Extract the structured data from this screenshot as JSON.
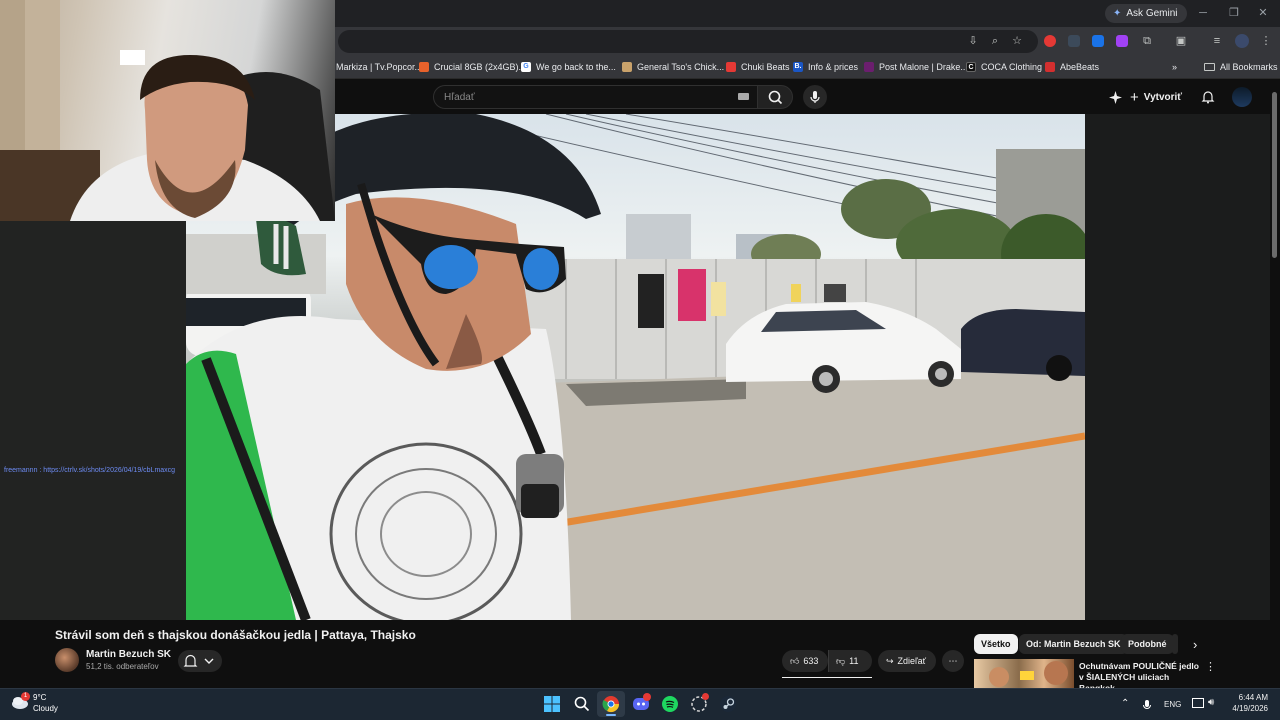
{
  "browser": {
    "ask_gemini": "Ask Gemini",
    "bookmarks": [
      {
        "label": "Markiza | Tv.Popcor...",
        "color": "#35363a",
        "glyph": ""
      },
      {
        "label": "Crucial 8GB (2x4GB)...",
        "color": "#e8622b",
        "glyph": ""
      },
      {
        "label": "We go back to the...",
        "color": "#ffffff",
        "glyph": "G"
      },
      {
        "label": "General Tso's Chick...",
        "color": "#c9a26b",
        "glyph": ""
      },
      {
        "label": "Chuki Beats",
        "color": "#e53935",
        "glyph": ""
      },
      {
        "label": "Info & prices",
        "color": "#1a56c5",
        "glyph": "B."
      },
      {
        "label": "Post Malone | Drake...",
        "color": "#6b1e6e",
        "glyph": ""
      },
      {
        "label": "COCA Clothing",
        "color": "#111111",
        "glyph": "C"
      },
      {
        "label": "AbeBeats",
        "color": "#d32f2f",
        "glyph": ""
      }
    ],
    "all_bookmarks": "All Bookmarks"
  },
  "youtube": {
    "search_placeholder": "Hľadať",
    "create_label": "Vytvoriť"
  },
  "stream": {
    "overlay_text": "freemannn : https://ctrlv.sk/shots/2026/04/19/cbLmaxcg"
  },
  "video": {
    "title": "Strávil som deň s thajskou donášačkou jedla | Pattaya, Thajsko",
    "channel_name": "Martin Bezuch SK",
    "subscribers": "51,2 tis. odberateľov",
    "likes": "633",
    "dislikes": "11",
    "share_label": "Zdieľať"
  },
  "recommendations": {
    "chips": [
      "Všetko",
      "Od: Martin Bezuch SK",
      "Podobné"
    ],
    "first_title": "Ochutnávam POULIČNÉ jedlo v ŠIALENÝCH uliciach Bangkok..."
  },
  "taskbar": {
    "weather_temp": "9°C",
    "weather_desc": "Cloudy",
    "weather_badge": "1",
    "language": "ENG",
    "time": "6:44 AM",
    "date": "4/19/2026"
  }
}
